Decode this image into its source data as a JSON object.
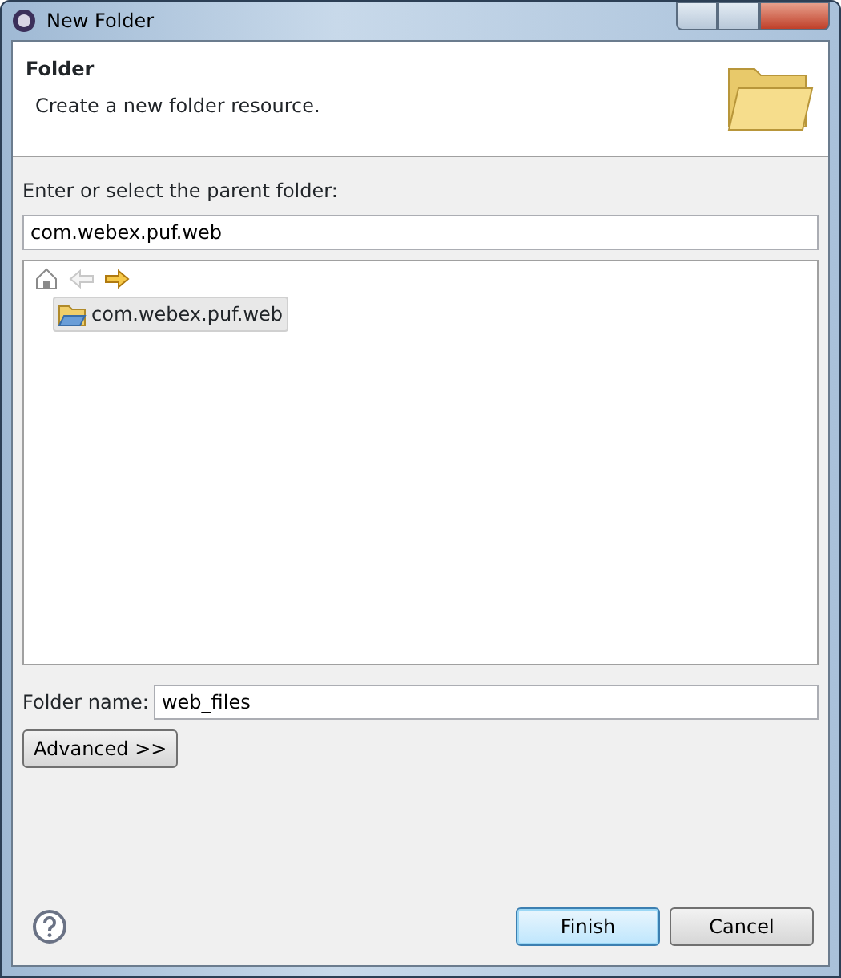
{
  "window": {
    "title": "New Folder"
  },
  "header": {
    "title": "Folder",
    "description": "Create a new folder resource."
  },
  "parent": {
    "label": "Enter or select the parent folder:",
    "value": "com.webex.puf.web"
  },
  "tree": {
    "toolbar": [
      {
        "kind": "home",
        "disabled": false
      },
      {
        "kind": "back",
        "disabled": true
      },
      {
        "kind": "forward",
        "disabled": false
      }
    ],
    "items": [
      {
        "label": "com.webex.puf.web",
        "selected": true
      }
    ]
  },
  "folder_name": {
    "label": "Folder name:",
    "value": "web_files"
  },
  "advanced_button": "Advanced >>",
  "buttons": [
    {
      "label": "Finish",
      "default": true
    },
    {
      "label": "Cancel",
      "default": false
    }
  ]
}
